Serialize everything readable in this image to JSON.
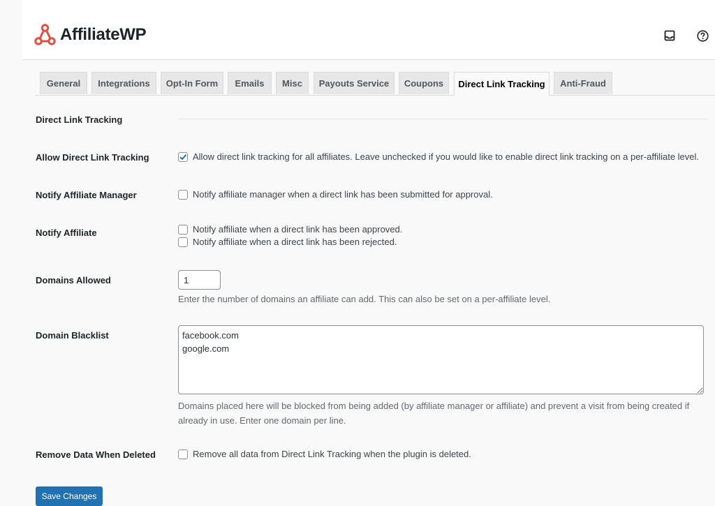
{
  "header": {
    "brand": "AffiliateWP",
    "brand_color": "#e34f43",
    "icons": [
      "inbox-icon",
      "help-icon"
    ]
  },
  "tabs": [
    {
      "label": "General",
      "active": false
    },
    {
      "label": "Integrations",
      "active": false
    },
    {
      "label": "Opt-In Form",
      "active": false
    },
    {
      "label": "Emails",
      "active": false
    },
    {
      "label": "Misc",
      "active": false
    },
    {
      "label": "Payouts Service",
      "active": false
    },
    {
      "label": "Coupons",
      "active": false
    },
    {
      "label": "Direct Link Tracking",
      "active": true
    },
    {
      "label": "Anti-Fraud",
      "active": false
    }
  ],
  "section": {
    "title": "Direct Link Tracking"
  },
  "fields": {
    "allow": {
      "label": "Allow Direct Link Tracking",
      "checkbox_label": "Allow direct link tracking for all affiliates. Leave unchecked if you would like to enable direct link tracking on a per-affiliate level.",
      "checked": true
    },
    "notify_manager": {
      "label": "Notify Affiliate Manager",
      "checkbox_label": "Notify affiliate manager when a direct link has been submitted for approval.",
      "checked": false
    },
    "notify_affiliate": {
      "label": "Notify Affiliate",
      "options": [
        {
          "label": "Notify affiliate when a direct link has been approved.",
          "checked": false
        },
        {
          "label": "Notify affiliate when a direct link has been rejected.",
          "checked": false
        }
      ]
    },
    "domains_allowed": {
      "label": "Domains Allowed",
      "value": "1",
      "description": "Enter the number of domains an affiliate can add. This can also be set on a per-affiliate level."
    },
    "blacklist": {
      "label": "Domain Blacklist",
      "value": "facebook.com\ngoogle.com",
      "description_line1": "Domains placed here will be blocked from being added (by affiliate manager or affiliate) and prevent a visit from being created if",
      "description_line2": "already in use. Enter one domain per line."
    },
    "remove_data": {
      "label": "Remove Data When Deleted",
      "checkbox_label": "Remove all data from Direct Link Tracking when the plugin is deleted.",
      "checked": false
    }
  },
  "actions": {
    "save_label": "Save Changes",
    "save_color": "#2271b1"
  }
}
